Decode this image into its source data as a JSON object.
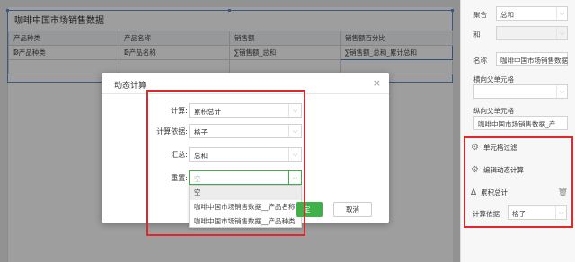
{
  "report": {
    "title": "咖啡中国市场销售数据",
    "table": {
      "headers": [
        "产品种类",
        "产品名称",
        "销售额",
        "销售额百分比"
      ],
      "cells": [
        "ↁ产品种类",
        "ↁ产品名称",
        "∑销售额_总和",
        "∑销售额_总和_累计总和"
      ]
    }
  },
  "dialog": {
    "title": "动态计算",
    "close": "×",
    "fields": [
      {
        "label": "计算:",
        "value": "累积总计"
      },
      {
        "label": "计算依据:",
        "value": "格子"
      },
      {
        "label": "汇总:",
        "value": "总和"
      },
      {
        "label": "重置:",
        "value": "空"
      }
    ],
    "dropdown_options": [
      "空",
      "咖啡中国市场销售数据__产品名称",
      "咖啡中国市场销售数据__产品种类"
    ],
    "ok_label": "定",
    "cancel_label": "取消"
  },
  "panel": {
    "aggregate_label": "聚合",
    "aggregate_value": "总和",
    "and_label": "和",
    "name_label": "名称",
    "name_value": "咖啡中国市场销售数据",
    "horizontal_parent_label": "横向父单元格",
    "vertical_parent_label": "纵向父单元格",
    "vertical_parent_value": "咖啡中国市场销售数据_产",
    "cell_filter_label": "单元格过滤",
    "edit_dynamic_calc_label": "编辑动态计算",
    "calc_item_label": "累积总计",
    "calc_basis_label": "计算依据",
    "calc_basis_value": "格子"
  },
  "colors": {
    "accent_green": "#3fb04a",
    "highlight_red": "#e3262b",
    "selection_blue": "#5b8fd6"
  }
}
